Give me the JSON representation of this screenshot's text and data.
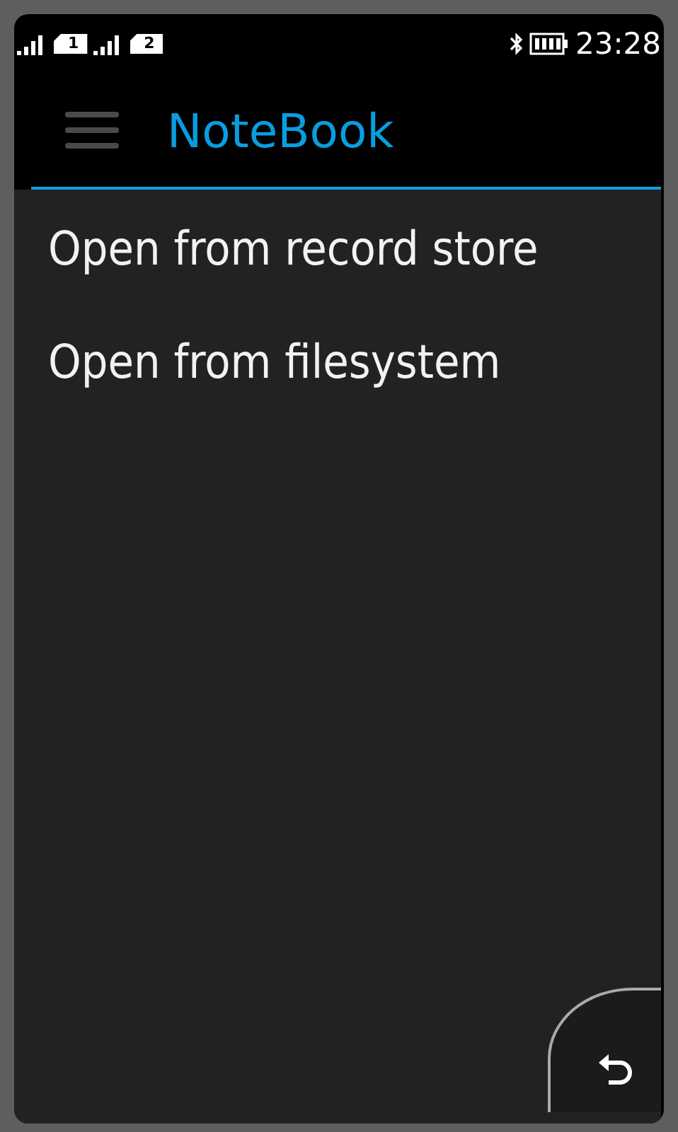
{
  "status_bar": {
    "sims": [
      "1",
      "2"
    ],
    "time": "23:28"
  },
  "header": {
    "title": "NoteBook"
  },
  "menu_items": [
    {
      "label": "Open from record store"
    },
    {
      "label": "Open from filesystem"
    }
  ]
}
